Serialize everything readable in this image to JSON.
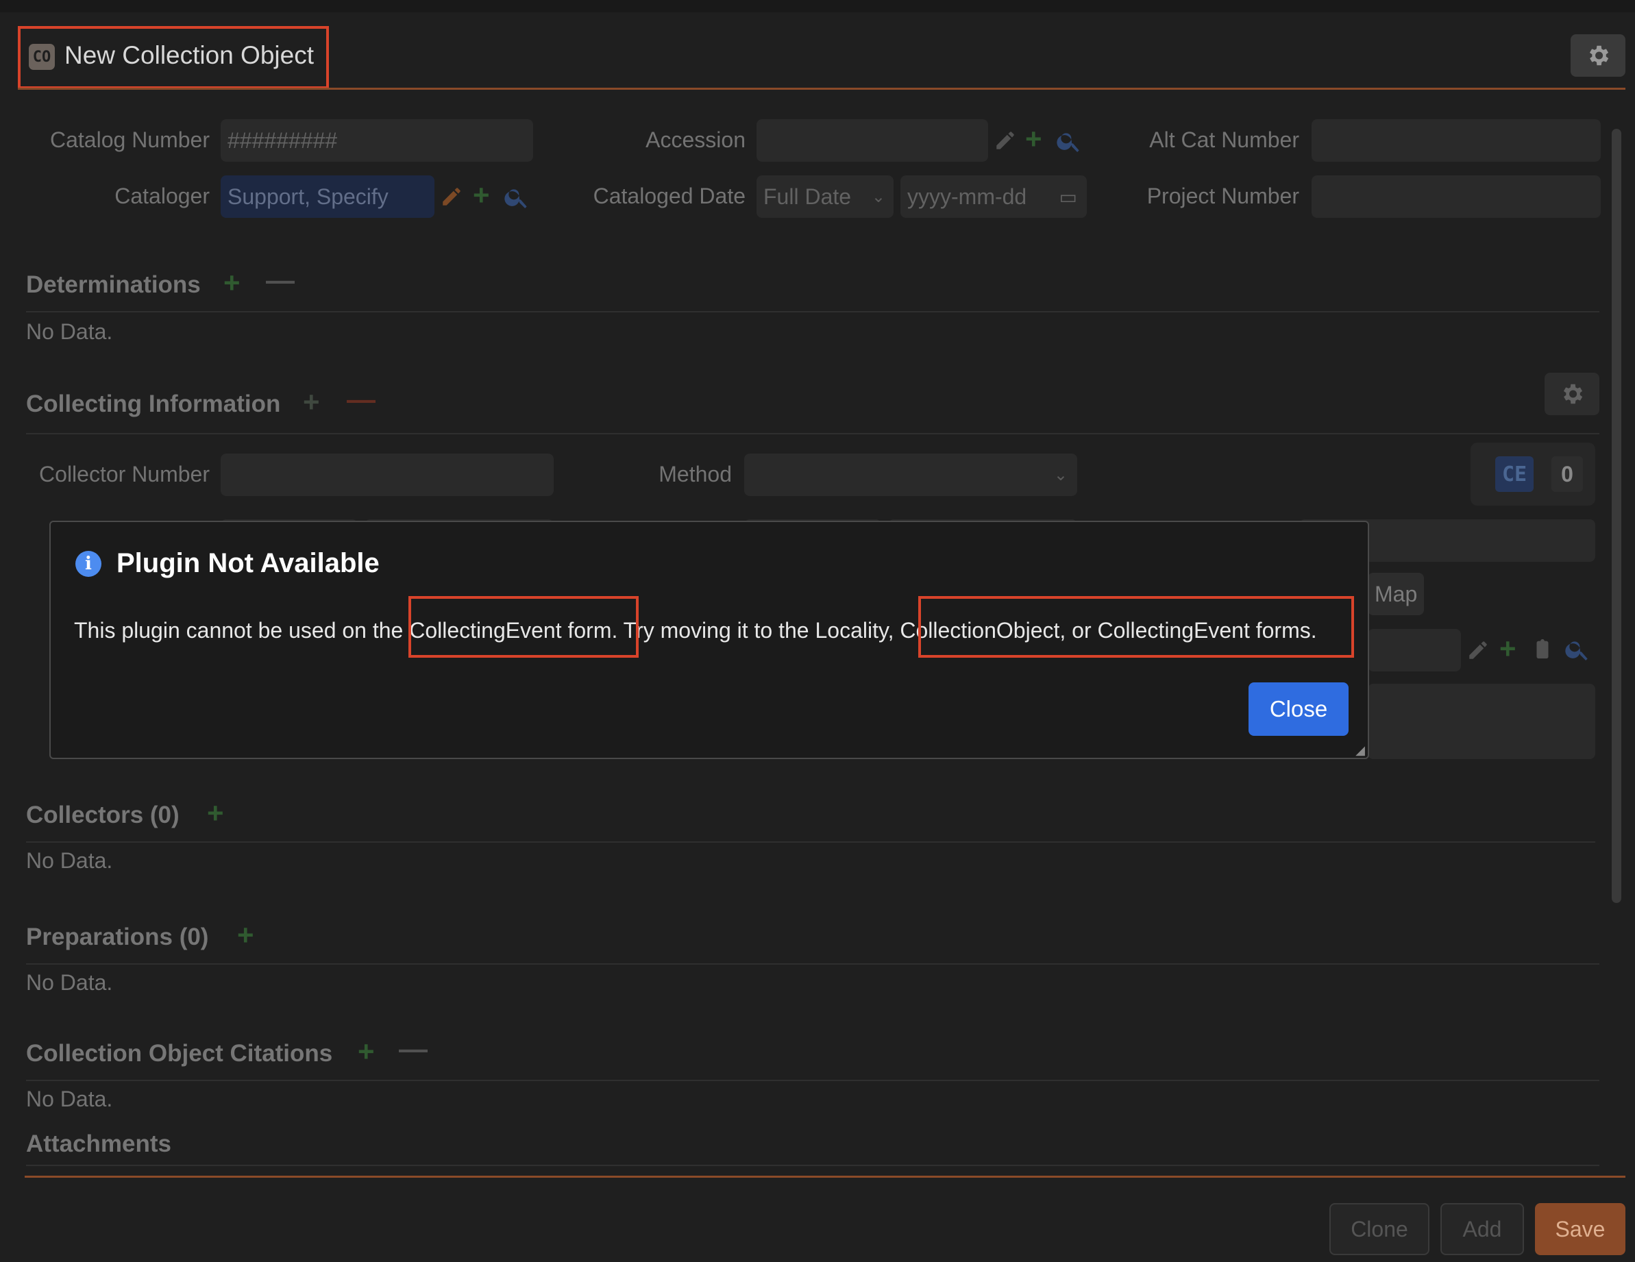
{
  "form": {
    "badge": "CO",
    "title": "New Collection Object",
    "fields": {
      "catalog_number_label": "Catalog Number",
      "catalog_number_placeholder": "#########",
      "accession_label": "Accession",
      "alt_cat_number_label": "Alt Cat Number",
      "cataloger_label": "Cataloger",
      "cataloger_value": "Support, Specify",
      "cataloged_date_label": "Cataloged Date",
      "cataloged_date_precision": "Full Date",
      "cataloged_date_placeholder": "yyyy-mm-dd",
      "project_number_label": "Project Number"
    }
  },
  "sections": {
    "determinations": "Determinations",
    "collecting_info": "Collecting Information",
    "collector_number_label": "Collector Number",
    "method_label": "Method",
    "ce_badge": "CE",
    "ce_count": "0",
    "map_label": "Map",
    "collectors": "Collectors (0)",
    "preparations": "Preparations (0)",
    "citations": "Collection Object Citations",
    "attachments": "Attachments",
    "no_data": "No Data."
  },
  "footer": {
    "clone": "Clone",
    "add": "Add",
    "save": "Save"
  },
  "dialog": {
    "title": "Plugin Not Available",
    "message": "This plugin cannot be used on the CollectingEvent form. Try moving it to the Locality, CollectionObject, or CollectingEvent forms.",
    "close": "Close"
  },
  "colors": {
    "highlight": "#d8432a",
    "primary_button": "#2f6ce0",
    "save_button": "#8a4a28",
    "add_icon": "#3e8a3e"
  }
}
